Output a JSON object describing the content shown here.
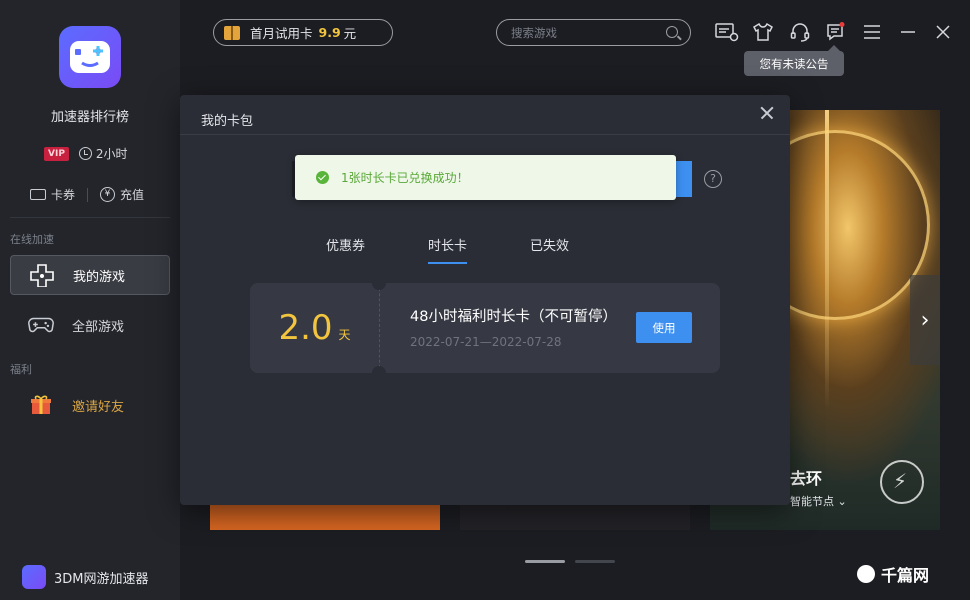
{
  "sidebar": {
    "rank_label": "加速器排行榜",
    "vip_badge": "VIP",
    "time_left": "2小时",
    "coupon_label": "卡券",
    "recharge_label": "充值",
    "section_online": "在线加速",
    "section_welfare": "福利",
    "items": [
      {
        "label": "我的游戏",
        "active": true
      },
      {
        "label": "全部游戏",
        "active": false
      },
      {
        "label": "邀请好友",
        "active": false
      }
    ],
    "brand": "3DM网游加速器"
  },
  "topbar": {
    "trial_text": "首月试用卡",
    "trial_price": "9.9",
    "trial_unit": "元",
    "search_placeholder": "搜索游戏",
    "tooltip": "您有未读公告"
  },
  "cards": {
    "game_title": "去环",
    "node_label": "智能节点"
  },
  "modal": {
    "title": "我的卡包",
    "toast": "1张时长卡已兑换成功！",
    "help": "?",
    "tabs": [
      "优惠券",
      "时长卡",
      "已失效"
    ],
    "active_tab": 1,
    "voucher": {
      "amount": "2.0",
      "unit": "天",
      "title": "48小时福利时长卡（不可暂停）",
      "date_range": "2022-07-21—2022-07-28",
      "use_label": "使用"
    }
  },
  "watermark": "千篇网",
  "colors": {
    "accent": "#3d8ff0",
    "gold": "#f3c53e",
    "success": "#58b43a",
    "vip": "#c8213f"
  }
}
